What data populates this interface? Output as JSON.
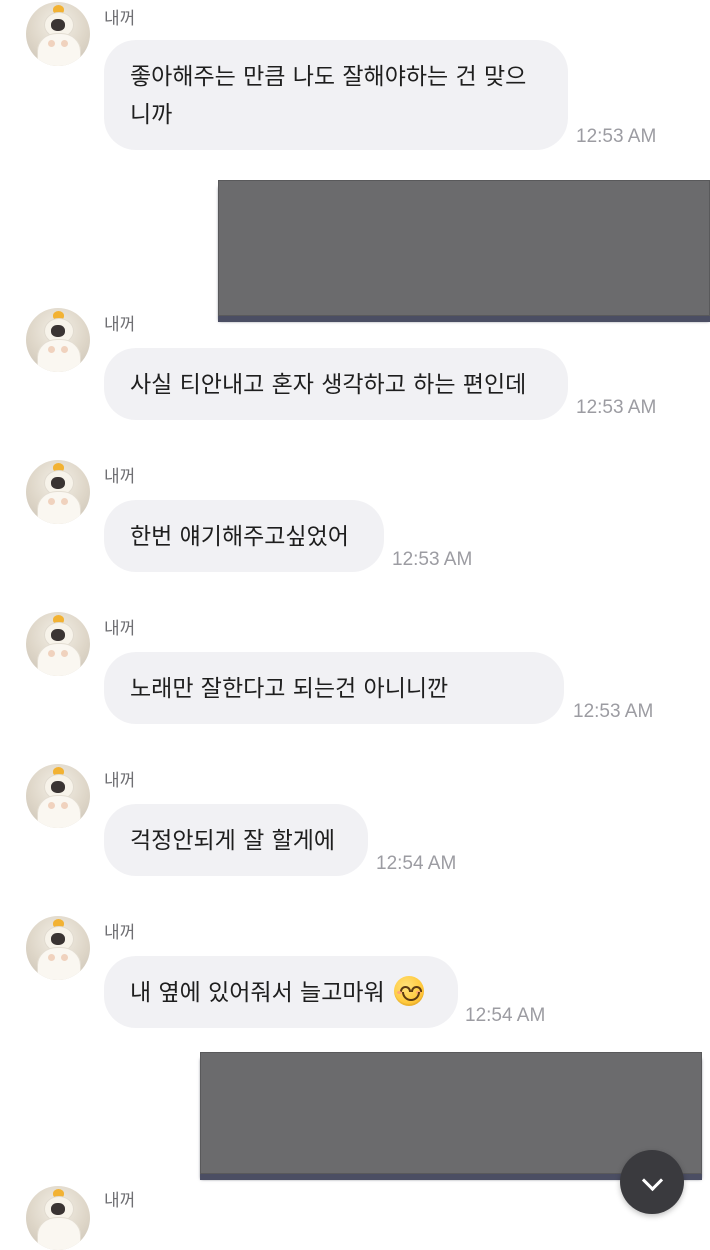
{
  "messages": [
    {
      "sender": "내꺼",
      "lines": [
        "좋아해주는 만큼 나도 잘해야하는 건 맞으",
        "니까"
      ],
      "time": "12:53 AM"
    },
    {
      "sender": "내꺼",
      "text": "사실 티안내고 혼자 생각하고 하는 편인데",
      "time": "12:53 AM"
    },
    {
      "sender": "내꺼",
      "text": "한번 얘기해주고싶었어",
      "time": "12:53 AM"
    },
    {
      "sender": "내꺼",
      "text": "노래만 잘한다고 되는건 아니니깐",
      "time": "12:53 AM"
    },
    {
      "sender": "내꺼",
      "text": "걱정안되게 잘 할게에",
      "time": "12:54 AM"
    },
    {
      "sender": "내꺼",
      "text": "내 옆에 있어줘서 늘고마워",
      "emoji": "smiling-face-emoji",
      "time": "12:54 AM"
    },
    {
      "sender": "내꺼"
    }
  ],
  "colors": {
    "bubble": "#f1f1f4",
    "redaction": "#6b6b6d",
    "timestamp": "#9c9ca2",
    "sender": "#6f6f73"
  },
  "icons": {
    "scroll_down": "chevron-down-icon"
  }
}
